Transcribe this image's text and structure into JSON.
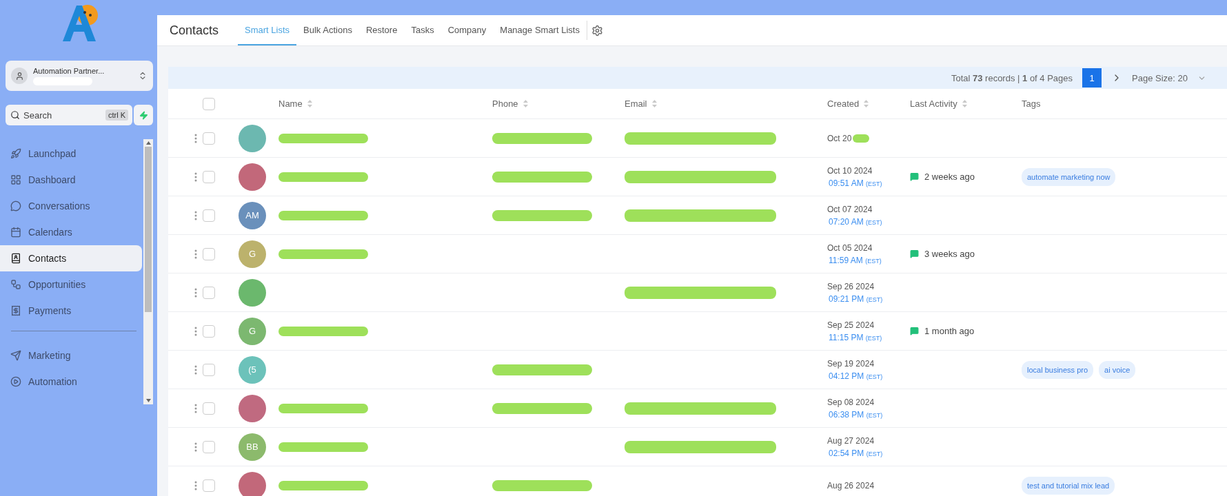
{
  "sidebar": {
    "account": {
      "name": "Automation Partner...",
      "subtitle_redacted": true
    },
    "search": {
      "placeholder": "Search",
      "shortcut": "ctrl K"
    },
    "items": [
      {
        "kind": "launchpad",
        "label": "Launchpad",
        "selected": false
      },
      {
        "kind": "dashboard",
        "label": "Dashboard",
        "selected": false
      },
      {
        "kind": "conversations",
        "label": "Conversations",
        "selected": false
      },
      {
        "kind": "calendars",
        "label": "Calendars",
        "selected": false
      },
      {
        "kind": "contacts",
        "label": "Contacts",
        "selected": true
      },
      {
        "kind": "opportunities",
        "label": "Opportunities",
        "selected": false
      },
      {
        "kind": "payments",
        "label": "Payments",
        "selected": false
      },
      {
        "kind": "divider"
      },
      {
        "kind": "marketing",
        "label": "Marketing",
        "selected": false
      },
      {
        "kind": "automation",
        "label": "Automation",
        "selected": false
      }
    ]
  },
  "header": {
    "title": "Contacts",
    "tabs": [
      {
        "label": "Smart Lists",
        "selected": true
      },
      {
        "label": "Bulk Actions",
        "selected": false
      },
      {
        "label": "Restore",
        "selected": false
      },
      {
        "label": "Tasks",
        "selected": false
      },
      {
        "label": "Company",
        "selected": false
      },
      {
        "label": "Manage Smart Lists",
        "selected": false
      }
    ]
  },
  "pagination": {
    "total_text": "Total **73** records | **1** of 4 Pages",
    "page": "1",
    "page_size": "Page Size: 20"
  },
  "table": {
    "select_all_checked": false,
    "columns": [
      "Name",
      "Phone",
      "Email",
      "Created",
      "Last Activity",
      "Tags"
    ],
    "rows": [
      {
        "checked": false,
        "avatar": {
          "color": "#6cb8b0"
        },
        "name_redacted": true,
        "phone_redacted": true,
        "email_redacted": true,
        "created": "Oct 20",
        "created_redacted": true,
        "tags": []
      },
      {
        "checked": false,
        "avatar": {
          "color": "#c2687a"
        },
        "name_redacted": true,
        "phone_redacted": true,
        "email_redacted": true,
        "created": "Oct 10 2024",
        "time": "09:51 AM",
        "tz": "(EST)",
        "activity": "2 weeks ago",
        "tags": [
          "automate marketing now"
        ]
      },
      {
        "checked": false,
        "avatar": {
          "initials": "AM",
          "color": "#6a90bb"
        },
        "name_redacted": true,
        "phone_redacted": true,
        "email_redacted": true,
        "created": "Oct 07 2024",
        "time": "07:20 AM",
        "tz": "(EST)",
        "tags": []
      },
      {
        "checked": false,
        "avatar": {
          "initials": "G",
          "color": "#bcb26c"
        },
        "name_redacted": true,
        "phone_redacted": false,
        "email_redacted": false,
        "created": "Oct 05 2024",
        "time": "11:59 AM",
        "tz": "(EST)",
        "activity": "3 weeks ago",
        "tags": []
      },
      {
        "checked": false,
        "avatar": {
          "color": "#6bb86d"
        },
        "name_redacted": false,
        "phone_redacted": false,
        "email_redacted": true,
        "created": "Sep 26 2024",
        "time": "09:21 PM",
        "tz": "(EST)",
        "tags": []
      },
      {
        "checked": false,
        "avatar": {
          "initials": "G",
          "color": "#7cb870"
        },
        "name_redacted": true,
        "phone_redacted": false,
        "email_redacted": false,
        "created": "Sep 25 2024",
        "time": "11:15 PM",
        "tz": "(EST)",
        "activity": "1 month ago",
        "tags": []
      },
      {
        "checked": false,
        "avatar": {
          "initials": "(5",
          "color": "#6cc2ba"
        },
        "name_redacted": false,
        "phone_redacted": true,
        "email_redacted": false,
        "created": "Sep 19 2024",
        "time": "04:12 PM",
        "tz": "(EST)",
        "tags": [
          "local business pro",
          "ai voice"
        ]
      },
      {
        "checked": false,
        "avatar": {
          "color": "#c06a80"
        },
        "name_redacted": true,
        "phone_redacted": true,
        "email_redacted": true,
        "created": "Sep 08 2024",
        "time": "06:38 PM",
        "tz": "(EST)",
        "tags": []
      },
      {
        "checked": false,
        "avatar": {
          "initials": "BB",
          "color": "#8cba6c"
        },
        "name_redacted": true,
        "phone_redacted": false,
        "email_redacted": true,
        "created": "Aug 27 2024",
        "time": "02:54 PM",
        "tz": "(EST)",
        "tags": []
      },
      {
        "checked": false,
        "avatar": {
          "color": "#c2687a"
        },
        "name_redacted": true,
        "phone_redacted": true,
        "email_redacted": false,
        "created": "Aug 26 2024",
        "tags": [
          "test and tutorial mix lead"
        ]
      }
    ]
  }
}
